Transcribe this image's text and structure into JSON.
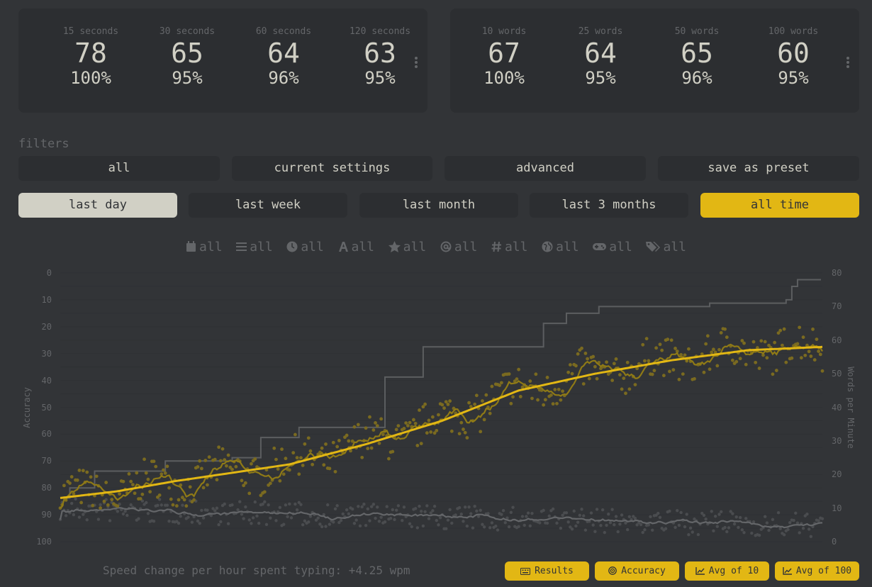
{
  "personal_bests": {
    "time": [
      {
        "label": "15 seconds",
        "wpm": "78",
        "acc": "100%"
      },
      {
        "label": "30 seconds",
        "wpm": "65",
        "acc": "95%"
      },
      {
        "label": "60 seconds",
        "wpm": "64",
        "acc": "96%"
      },
      {
        "label": "120 seconds",
        "wpm": "63",
        "acc": "95%"
      }
    ],
    "words": [
      {
        "label": "10 words",
        "wpm": "67",
        "acc": "100%"
      },
      {
        "label": "25 words",
        "wpm": "64",
        "acc": "95%"
      },
      {
        "label": "50 words",
        "wpm": "65",
        "acc": "96%"
      },
      {
        "label": "100 words",
        "wpm": "60",
        "acc": "95%"
      }
    ]
  },
  "filters": {
    "title": "filters",
    "presets": [
      "all",
      "current settings",
      "advanced",
      "save as preset"
    ],
    "ranges": [
      "last day",
      "last week",
      "last month",
      "last 3 months",
      "all time"
    ]
  },
  "chips": [
    {
      "icon": "calendar-icon",
      "label": "all"
    },
    {
      "icon": "list-icon",
      "label": "all"
    },
    {
      "icon": "clock-icon",
      "label": "all"
    },
    {
      "icon": "font-icon",
      "label": "all"
    },
    {
      "icon": "star-icon",
      "label": "all"
    },
    {
      "icon": "at-icon",
      "label": "all"
    },
    {
      "icon": "hashtag-icon",
      "label": "all"
    },
    {
      "icon": "globe-icon",
      "label": "all"
    },
    {
      "icon": "gamepad-icon",
      "label": "all"
    },
    {
      "icon": "tags-icon",
      "label": "all"
    }
  ],
  "chart_data": {
    "type": "line",
    "ylabel_left": "Accuracy",
    "ylabel_right": "Words per Minute",
    "y_left_ticks": [
      "0",
      "10",
      "20",
      "30",
      "40",
      "50",
      "60",
      "70",
      "80",
      "90",
      "100"
    ],
    "y_left_range": [
      100,
      0
    ],
    "y_right_ticks": [
      "80",
      "70",
      "60",
      "50",
      "40",
      "30",
      "20",
      "10",
      "0"
    ],
    "y_right_range": [
      0,
      80
    ],
    "grid": true,
    "x_count": 400,
    "series": [
      {
        "name": "Results",
        "color": "#e2b714",
        "style": "scatter",
        "start": 13,
        "end": 62
      },
      {
        "name": "Accuracy",
        "color": "#646669",
        "style": "scatter",
        "start": 88,
        "end": 94
      },
      {
        "name": "Avg of 10",
        "color": "#8f7a16",
        "style": "line"
      },
      {
        "name": "Avg of 100",
        "color": "#e2b714",
        "style": "line",
        "points": [
          [
            0,
            13
          ],
          [
            30,
            15
          ],
          [
            60,
            18
          ],
          [
            120,
            23
          ],
          [
            160,
            29
          ],
          [
            200,
            36
          ],
          [
            240,
            45
          ],
          [
            280,
            50
          ],
          [
            320,
            54
          ],
          [
            360,
            57
          ],
          [
            400,
            58
          ]
        ]
      },
      {
        "name": "",
        "color": "#5c5e60",
        "style": "step",
        "steps": [
          [
            0,
            13
          ],
          [
            5,
            16
          ],
          [
            18,
            21
          ],
          [
            55,
            24
          ],
          [
            90,
            25
          ],
          [
            105,
            31
          ],
          [
            125,
            34
          ],
          [
            170,
            49
          ],
          [
            190,
            58
          ],
          [
            253,
            65
          ],
          [
            265,
            68
          ],
          [
            282,
            70
          ],
          [
            340,
            71
          ],
          [
            380,
            72
          ],
          [
            383,
            76
          ],
          [
            386,
            78
          ]
        ]
      }
    ]
  },
  "footer": {
    "speed_change": "Speed change per hour spent typing: +4.25 wpm"
  },
  "legend": [
    {
      "icon": "keyboard-icon",
      "label": "Results"
    },
    {
      "icon": "bullseye-icon",
      "label": "Accuracy"
    },
    {
      "icon": "chart-line-icon",
      "label": "Avg of 10"
    },
    {
      "icon": "chart-line-icon",
      "label": "Avg of 100"
    }
  ],
  "colors": {
    "bg": "#323437",
    "card": "#2c2e31",
    "text": "#d1d0c5",
    "sub": "#646669",
    "accent": "#e2b714"
  }
}
